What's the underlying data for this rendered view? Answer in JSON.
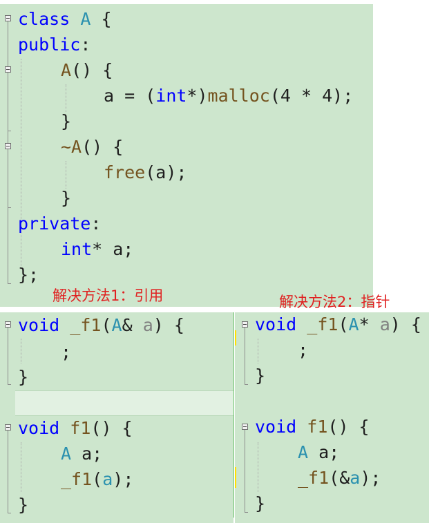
{
  "class_block": {
    "class_kw": "class",
    "class_name": "A",
    "open": " {",
    "public_kw": "public",
    "public_colon": ":",
    "ctor_name": "A",
    "ctor_tail": "() {",
    "assign_pre": "a = (",
    "int_kw": "int",
    "assign_cast": "*)",
    "malloc": "malloc",
    "assign_args": "(4 * 4);",
    "close": "}",
    "dtor_name": "~A",
    "dtor_tail": "() {",
    "free": "free",
    "free_args": "(a);",
    "private_kw": "private",
    "private_colon": ":",
    "member_type": "int",
    "member_rest": "* a;",
    "class_end": "};"
  },
  "annotations": {
    "solution1": "解决方法1：引用",
    "solution2": "解决方法2：指针"
  },
  "left_code": {
    "void_kw": "void",
    "fn_name": "_f1",
    "paren_open": "(",
    "param_type": "A",
    "amp": "&",
    "param_name": "a",
    "sig_end": ") {",
    "semi": ";",
    "close": "}",
    "void_kw2": "void",
    "fn2_name": "f1",
    "fn2_tail": "() {",
    "local_type": "A",
    "local_name": "a;",
    "call_name": "_f1",
    "call_open": "(",
    "call_arg": "a",
    "call_close": ");",
    "close2": "}"
  },
  "right_code": {
    "void_kw": "void",
    "fn_name": "_f1",
    "paren_open": "(",
    "param_type": "A",
    "star": "*",
    "param_name": "a",
    "sig_end": ") {",
    "semi": ";",
    "close": "}",
    "void_kw2": "void",
    "fn2_name": "f1",
    "fn2_tail": "() {",
    "local_type": "A",
    "local_name": "a;",
    "call_name": "_f1",
    "call_open": "(&",
    "call_arg": "a",
    "call_close": ");",
    "close2": "}"
  },
  "colors": {
    "keyword": "#0000ff",
    "type": "#2b91af",
    "function": "#74531f",
    "parameter": "#808080",
    "text": "#1e1e1e",
    "panel_bg": "#cde6cd",
    "annotation": "#e02020"
  }
}
